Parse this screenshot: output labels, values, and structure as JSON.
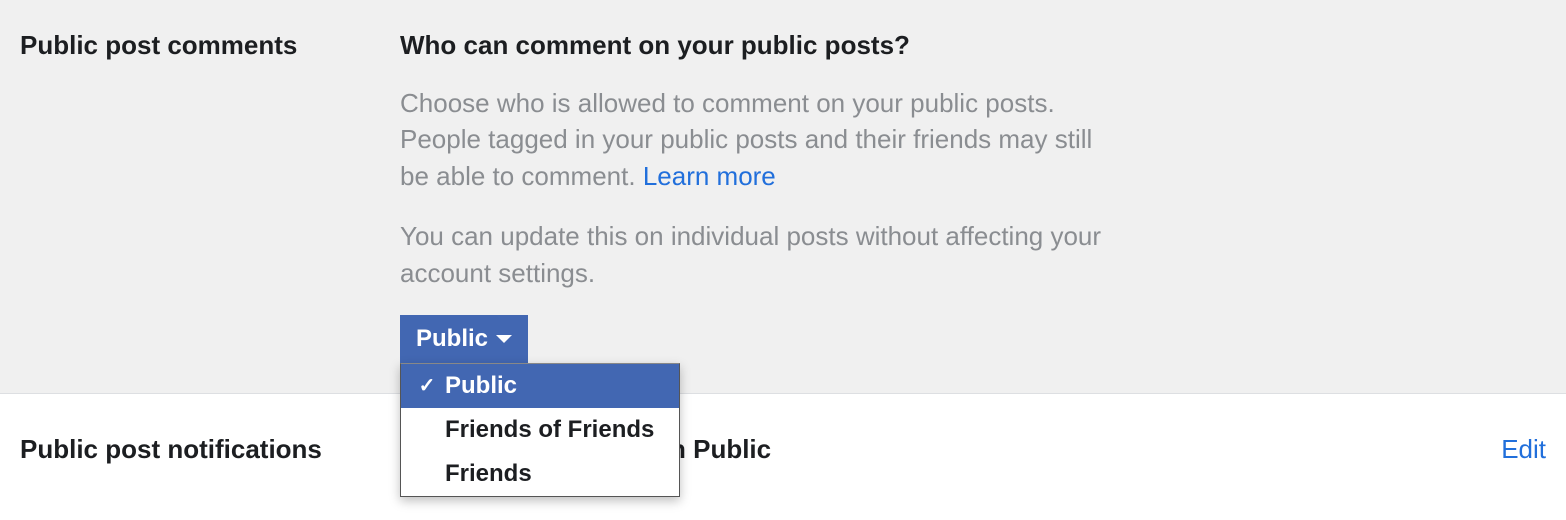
{
  "section1": {
    "label": "Public post comments",
    "heading": "Who can comment on your public posts?",
    "desc1": "Choose who is allowed to comment on your public posts. People tagged in your public posts and their friends may still be able to comment. ",
    "learn_more": "Learn more",
    "desc2": "You can update this on individual posts without affecting your account settings.",
    "dropdown_label": "Public",
    "options": {
      "opt1": "Public",
      "opt2": "Friends of Friends",
      "opt3": "Friends"
    }
  },
  "section2": {
    "label": "Public post notifications",
    "value_partial": "n Public",
    "edit": "Edit"
  }
}
